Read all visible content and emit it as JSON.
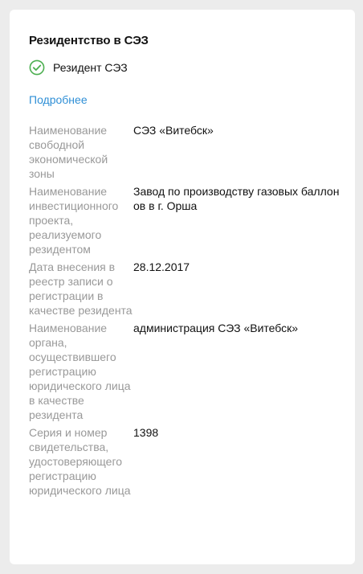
{
  "section": {
    "title": "Резидентство в СЭЗ",
    "status_label": "Резидент СЭЗ",
    "status_icon": "check-circle-icon",
    "accent_green": "#4caf50",
    "more_link": "Подробнее",
    "link_color": "#2f8fd6"
  },
  "rows": [
    {
      "label": "Наименование свободной экономической зоны",
      "value": "СЭЗ «Витебск»"
    },
    {
      "label": "Наименование инвестиционного проекта, реализуемого резидентом",
      "value": "Завод по производству газовых баллонов в г. Орша"
    },
    {
      "label": "Дата внесения в реестр записи о регистрации в качестве резидента",
      "value": "28.12.2017"
    },
    {
      "label": "Наименование органа, осуществившего регистрацию юридического лица в качестве резидента",
      "value": "администрация СЭЗ «Витебск»"
    },
    {
      "label": "Серия и номер свидетельства, удостоверяющего регистрацию юридического лица",
      "value": "1398"
    }
  ]
}
